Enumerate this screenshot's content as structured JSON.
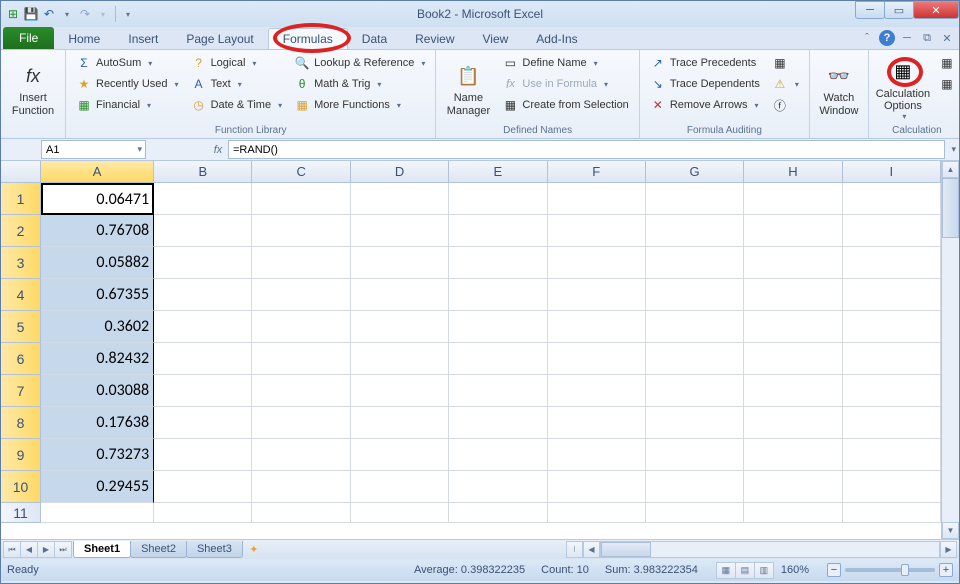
{
  "title": "Book2 - Microsoft Excel",
  "qat_icons": [
    "excel",
    "save",
    "undo",
    "redo"
  ],
  "tabs": {
    "file": "File",
    "list": [
      "Home",
      "Insert",
      "Page Layout",
      "Formulas",
      "Data",
      "Review",
      "View",
      "Add-Ins"
    ],
    "active": "Formulas"
  },
  "ribbon": {
    "insert_fn": {
      "label": "Insert\nFunction"
    },
    "library": {
      "label": "Function Library",
      "items": [
        "AutoSum",
        "Recently Used",
        "Financial",
        "Logical",
        "Text",
        "Date & Time",
        "Lookup & Reference",
        "Math & Trig",
        "More Functions"
      ]
    },
    "name_mgr": {
      "big": "Name\nManager",
      "items": [
        "Define Name",
        "Use in Formula",
        "Create from Selection"
      ],
      "label": "Defined Names"
    },
    "audit": {
      "items": [
        "Trace Precedents",
        "Trace Dependents",
        "Remove Arrows"
      ],
      "label": "Formula Auditing"
    },
    "watch": {
      "label": "Watch\nWindow"
    },
    "calc": {
      "big": "Calculation\nOptions",
      "label": "Calculation"
    }
  },
  "namebox": "A1",
  "formula": "=RAND()",
  "columns": [
    "A",
    "B",
    "C",
    "D",
    "E",
    "F",
    "G",
    "H",
    "I"
  ],
  "rows": [
    "1",
    "2",
    "3",
    "4",
    "5",
    "6",
    "7",
    "8",
    "9",
    "10",
    "11"
  ],
  "data_a": [
    "0.06471",
    "0.76708",
    "0.05882",
    "0.67355",
    "0.3602",
    "0.82432",
    "0.03088",
    "0.17638",
    "0.73273",
    "0.29455"
  ],
  "sheets": [
    "Sheet1",
    "Sheet2",
    "Sheet3"
  ],
  "status": {
    "ready": "Ready",
    "avg_label": "Average:",
    "avg": "0.398322235",
    "count_label": "Count:",
    "count": "10",
    "sum_label": "Sum:",
    "sum": "3.983222354",
    "zoom": "160%"
  }
}
